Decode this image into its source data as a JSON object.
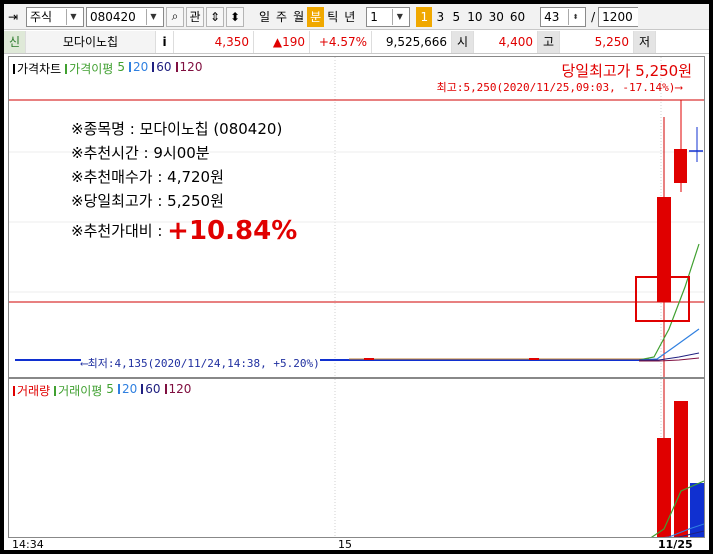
{
  "toolbar": {
    "market_type": "주식",
    "stock_code": "080420",
    "watch_button": "관",
    "period_buttons": [
      "일",
      "주",
      "월",
      "분",
      "틱",
      "년"
    ],
    "active_period": "분",
    "interval_value": "1",
    "interval_shortcuts": [
      "1",
      "3",
      "5",
      "10",
      "30",
      "60"
    ],
    "active_interval": "1",
    "count_value": "43",
    "slash": "/",
    "total_value": "1200"
  },
  "quote": {
    "badge": "신",
    "stock_name": "모다이노칩",
    "info_icon": "i",
    "price": "4,350",
    "change": "▲190",
    "change_pct": "+4.57%",
    "volume": "9,525,666",
    "open_label": "시",
    "open": "4,400",
    "high_label": "고",
    "high": "5,250",
    "low_label": "저"
  },
  "price_panel": {
    "legend": [
      "가격차트",
      "가격이평",
      "5",
      "20",
      "60",
      "120"
    ],
    "annotation_title": "당일최고가 5,250원",
    "high_detail": "최고:5,250(2020/11/25,09:03, -17.14%)⟶",
    "low_detail": "⟵최저:4,135(2020/11/24,14:38, +5.20%)",
    "info": {
      "line1": "※종목명 : 모다이노칩 (080420)",
      "line2": "※추천시간 : 9시00분",
      "line3": "※추천매수가 : 4,720원",
      "line4": "※당일최고가 : 5,250원",
      "line5_label": "※추천가대비 : ",
      "line5_value": "+10.84%"
    }
  },
  "volume_panel": {
    "legend": [
      "거래량",
      "거래이평",
      "5",
      "20",
      "60",
      "120"
    ]
  },
  "x_axis": {
    "labels": [
      "14:34",
      "15",
      "11/25"
    ]
  },
  "colors": {
    "up": "#e00000",
    "down": "#1030d0",
    "ma5": "#40a030",
    "ma20": "#3080e0",
    "ma60": "#202080",
    "ma120": "#801040",
    "accent": "#f0a800"
  }
}
